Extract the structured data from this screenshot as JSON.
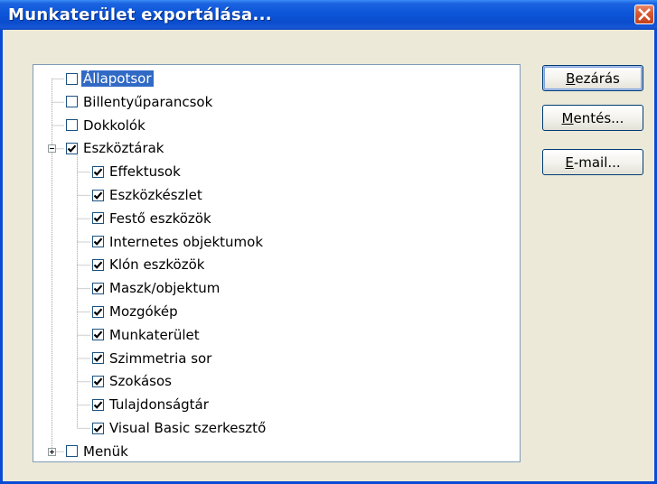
{
  "window": {
    "title": "Munkaterület exportálása..."
  },
  "icons": {
    "close": "close-icon",
    "check": "checkmark-icon",
    "expand": "plus-icon",
    "collapse": "minus-icon"
  },
  "colors": {
    "titlebar": "#0a4dcc",
    "selection": "#316ac5",
    "close": "#d9572f",
    "dialog": "#ece9d8"
  },
  "tree": {
    "items": [
      {
        "label": "Állapotsor",
        "checked": false,
        "level": 0,
        "selected": true
      },
      {
        "label": "Billentyűparancsok",
        "checked": false,
        "level": 0
      },
      {
        "label": "Dokkolók",
        "checked": false,
        "level": 0
      },
      {
        "label": "Eszköztárak",
        "checked": true,
        "level": 0,
        "expander": "collapse"
      },
      {
        "label": "Effektusok",
        "checked": true,
        "level": 1
      },
      {
        "label": "Eszközkészlet",
        "checked": true,
        "level": 1
      },
      {
        "label": "Festő eszközök",
        "checked": true,
        "level": 1
      },
      {
        "label": "Internetes objektumok",
        "checked": true,
        "level": 1
      },
      {
        "label": "Klón eszközök",
        "checked": true,
        "level": 1
      },
      {
        "label": "Maszk/objektum",
        "checked": true,
        "level": 1
      },
      {
        "label": "Mozgókép",
        "checked": true,
        "level": 1
      },
      {
        "label": "Munkaterület",
        "checked": true,
        "level": 1
      },
      {
        "label": "Szimmetria sor",
        "checked": true,
        "level": 1
      },
      {
        "label": "Szokásos",
        "checked": true,
        "level": 1
      },
      {
        "label": "Tulajdonságtár",
        "checked": true,
        "level": 1
      },
      {
        "label": "Visual Basic szerkesztő",
        "checked": true,
        "level": 1
      },
      {
        "label": "Menük",
        "checked": false,
        "level": 0,
        "expander": "expand"
      }
    ]
  },
  "buttons": {
    "close": {
      "mnemonic": "B",
      "rest": "ezárás"
    },
    "save": {
      "mnemonic": "M",
      "rest": "entés..."
    },
    "email": {
      "mnemonic": "E",
      "rest": "-mail..."
    }
  }
}
